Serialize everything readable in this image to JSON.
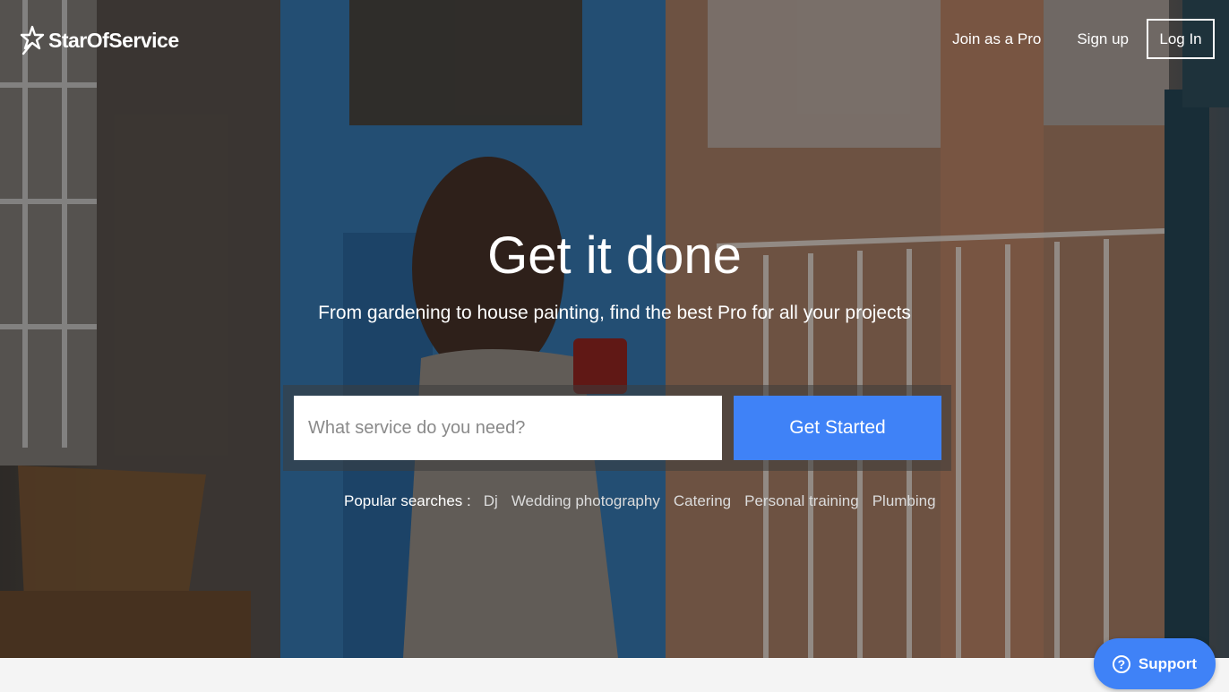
{
  "brand": {
    "name": "StarOfService"
  },
  "nav": {
    "join_pro": "Join as a Pro",
    "signup": "Sign up",
    "login": "Log In"
  },
  "hero": {
    "title": "Get it done",
    "subtitle": "From gardening to house painting, find the best Pro for all your projects"
  },
  "search": {
    "placeholder": "What service do you need?",
    "value": "",
    "button": "Get Started"
  },
  "popular": {
    "label": "Popular searches :",
    "items": [
      "Dj",
      "Wedding photography",
      "Catering",
      "Personal training",
      "Plumbing"
    ]
  },
  "support": {
    "label": "Support",
    "icon": "question-circle-icon"
  },
  "colors": {
    "accent": "#3f82f7",
    "text_light": "#ffffff"
  }
}
